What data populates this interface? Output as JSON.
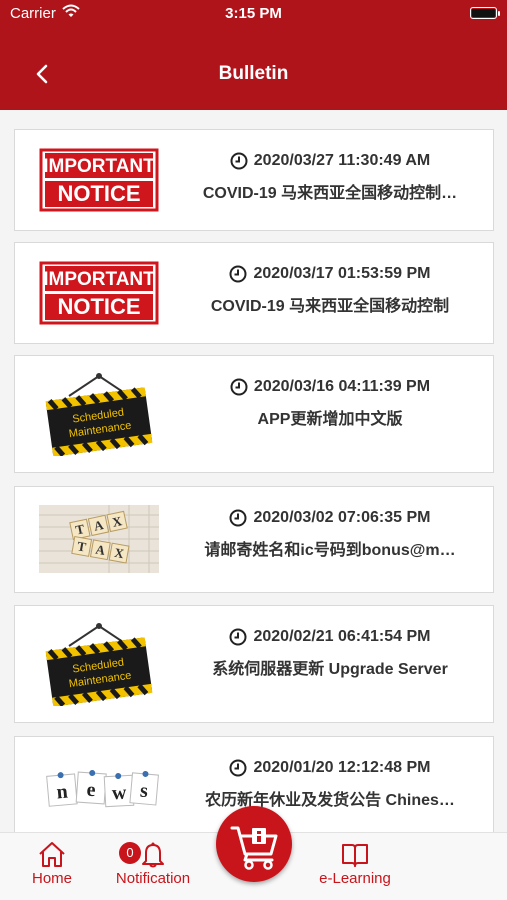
{
  "status_bar": {
    "carrier": "Carrier",
    "time": "3:15 PM"
  },
  "header": {
    "title": "Bulletin"
  },
  "notices": [
    {
      "image": "important-notice",
      "date": "2020/03/27 11:30:49 AM",
      "subject": "COVID-19 马来西亚全国移动控制…"
    },
    {
      "image": "important-notice",
      "date": "2020/03/17 01:53:59 PM",
      "subject": "COVID-19 马来西亚全国移动控制"
    },
    {
      "image": "scheduled-maintenance",
      "date": "2020/03/16 04:11:39 PM",
      "subject": "APP更新增加中文版"
    },
    {
      "image": "tax",
      "date": "2020/03/02 07:06:35 PM",
      "subject": "请邮寄姓名和ic号码到bonus@m…"
    },
    {
      "image": "scheduled-maintenance",
      "date": "2020/02/21 06:41:54 PM",
      "subject": "系统伺服器更新 Upgrade Server"
    },
    {
      "image": "news",
      "date": "2020/01/20 12:12:48 PM",
      "subject": "农历新年休业及发货公告 Chines…"
    }
  ],
  "images": {
    "important_line1": "IMPORTANT",
    "important_line2": "NOTICE",
    "maint_line1": "Scheduled",
    "maint_line2": "Maintenance",
    "tax_tiles": [
      "T",
      "A",
      "X",
      "T",
      "A",
      "X"
    ],
    "news_tiles": [
      "n",
      "e",
      "w",
      "s"
    ]
  },
  "tab_bar": {
    "home": "Home",
    "notification": "Notification",
    "notification_count": "0",
    "elearning": "e-Learning"
  },
  "colors": {
    "brand_red": "#b0141b",
    "accent_red": "#c8141b"
  }
}
